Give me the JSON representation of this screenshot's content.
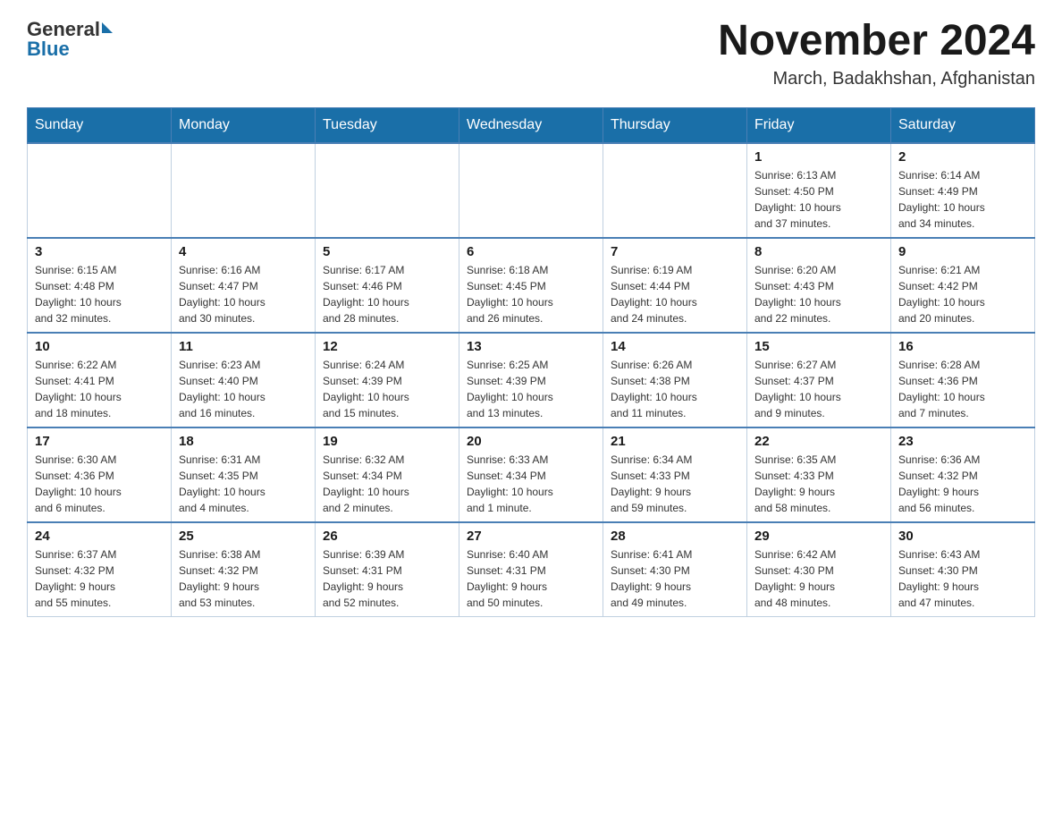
{
  "logo": {
    "text_general": "General",
    "text_blue": "Blue"
  },
  "title": "November 2024",
  "subtitle": "March, Badakhshan, Afghanistan",
  "days_of_week": [
    "Sunday",
    "Monday",
    "Tuesday",
    "Wednesday",
    "Thursday",
    "Friday",
    "Saturday"
  ],
  "weeks": [
    {
      "days": [
        {
          "number": "",
          "info": "",
          "empty": true
        },
        {
          "number": "",
          "info": "",
          "empty": true
        },
        {
          "number": "",
          "info": "",
          "empty": true
        },
        {
          "number": "",
          "info": "",
          "empty": true
        },
        {
          "number": "",
          "info": "",
          "empty": true
        },
        {
          "number": "1",
          "info": "Sunrise: 6:13 AM\nSunset: 4:50 PM\nDaylight: 10 hours\nand 37 minutes."
        },
        {
          "number": "2",
          "info": "Sunrise: 6:14 AM\nSunset: 4:49 PM\nDaylight: 10 hours\nand 34 minutes."
        }
      ]
    },
    {
      "days": [
        {
          "number": "3",
          "info": "Sunrise: 6:15 AM\nSunset: 4:48 PM\nDaylight: 10 hours\nand 32 minutes."
        },
        {
          "number": "4",
          "info": "Sunrise: 6:16 AM\nSunset: 4:47 PM\nDaylight: 10 hours\nand 30 minutes."
        },
        {
          "number": "5",
          "info": "Sunrise: 6:17 AM\nSunset: 4:46 PM\nDaylight: 10 hours\nand 28 minutes."
        },
        {
          "number": "6",
          "info": "Sunrise: 6:18 AM\nSunset: 4:45 PM\nDaylight: 10 hours\nand 26 minutes."
        },
        {
          "number": "7",
          "info": "Sunrise: 6:19 AM\nSunset: 4:44 PM\nDaylight: 10 hours\nand 24 minutes."
        },
        {
          "number": "8",
          "info": "Sunrise: 6:20 AM\nSunset: 4:43 PM\nDaylight: 10 hours\nand 22 minutes."
        },
        {
          "number": "9",
          "info": "Sunrise: 6:21 AM\nSunset: 4:42 PM\nDaylight: 10 hours\nand 20 minutes."
        }
      ]
    },
    {
      "days": [
        {
          "number": "10",
          "info": "Sunrise: 6:22 AM\nSunset: 4:41 PM\nDaylight: 10 hours\nand 18 minutes."
        },
        {
          "number": "11",
          "info": "Sunrise: 6:23 AM\nSunset: 4:40 PM\nDaylight: 10 hours\nand 16 minutes."
        },
        {
          "number": "12",
          "info": "Sunrise: 6:24 AM\nSunset: 4:39 PM\nDaylight: 10 hours\nand 15 minutes."
        },
        {
          "number": "13",
          "info": "Sunrise: 6:25 AM\nSunset: 4:39 PM\nDaylight: 10 hours\nand 13 minutes."
        },
        {
          "number": "14",
          "info": "Sunrise: 6:26 AM\nSunset: 4:38 PM\nDaylight: 10 hours\nand 11 minutes."
        },
        {
          "number": "15",
          "info": "Sunrise: 6:27 AM\nSunset: 4:37 PM\nDaylight: 10 hours\nand 9 minutes."
        },
        {
          "number": "16",
          "info": "Sunrise: 6:28 AM\nSunset: 4:36 PM\nDaylight: 10 hours\nand 7 minutes."
        }
      ]
    },
    {
      "days": [
        {
          "number": "17",
          "info": "Sunrise: 6:30 AM\nSunset: 4:36 PM\nDaylight: 10 hours\nand 6 minutes."
        },
        {
          "number": "18",
          "info": "Sunrise: 6:31 AM\nSunset: 4:35 PM\nDaylight: 10 hours\nand 4 minutes."
        },
        {
          "number": "19",
          "info": "Sunrise: 6:32 AM\nSunset: 4:34 PM\nDaylight: 10 hours\nand 2 minutes."
        },
        {
          "number": "20",
          "info": "Sunrise: 6:33 AM\nSunset: 4:34 PM\nDaylight: 10 hours\nand 1 minute."
        },
        {
          "number": "21",
          "info": "Sunrise: 6:34 AM\nSunset: 4:33 PM\nDaylight: 9 hours\nand 59 minutes."
        },
        {
          "number": "22",
          "info": "Sunrise: 6:35 AM\nSunset: 4:33 PM\nDaylight: 9 hours\nand 58 minutes."
        },
        {
          "number": "23",
          "info": "Sunrise: 6:36 AM\nSunset: 4:32 PM\nDaylight: 9 hours\nand 56 minutes."
        }
      ]
    },
    {
      "days": [
        {
          "number": "24",
          "info": "Sunrise: 6:37 AM\nSunset: 4:32 PM\nDaylight: 9 hours\nand 55 minutes."
        },
        {
          "number": "25",
          "info": "Sunrise: 6:38 AM\nSunset: 4:32 PM\nDaylight: 9 hours\nand 53 minutes."
        },
        {
          "number": "26",
          "info": "Sunrise: 6:39 AM\nSunset: 4:31 PM\nDaylight: 9 hours\nand 52 minutes."
        },
        {
          "number": "27",
          "info": "Sunrise: 6:40 AM\nSunset: 4:31 PM\nDaylight: 9 hours\nand 50 minutes."
        },
        {
          "number": "28",
          "info": "Sunrise: 6:41 AM\nSunset: 4:30 PM\nDaylight: 9 hours\nand 49 minutes."
        },
        {
          "number": "29",
          "info": "Sunrise: 6:42 AM\nSunset: 4:30 PM\nDaylight: 9 hours\nand 48 minutes."
        },
        {
          "number": "30",
          "info": "Sunrise: 6:43 AM\nSunset: 4:30 PM\nDaylight: 9 hours\nand 47 minutes."
        }
      ]
    }
  ]
}
